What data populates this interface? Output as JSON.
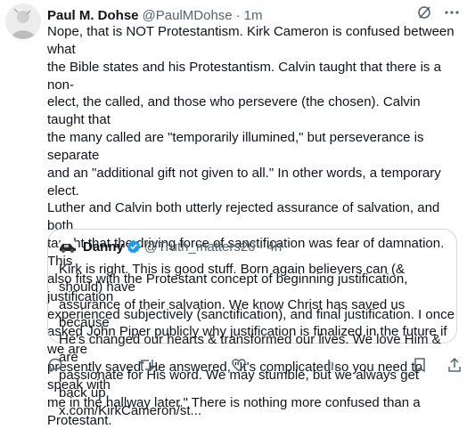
{
  "tweet": {
    "author_name": "Paul M. Dohse",
    "author_handle": "@PaulMDohse",
    "separator": "·",
    "time": "1m",
    "lines": [
      "Nope, that is NOT Protestantism. Kirk Cameron is confused between what",
      "the Bible states and his Protestantism. Calvin taught that there is a non-",
      "elect, the called, and those who persevere (the chosen). Calvin taught that",
      "the many called are \"temporarily illumined,\" but perseverance is separate",
      "and an \"additional gift not given to all.\" In other words, a temporary elect.",
      "Luther and Calvin both utterly rejected assurance of salvation, and both",
      "taught that the driving force of sanctification was fear of damnation. This",
      "also fits with the Protestant concept of beginning justification, justification",
      "experienced subjectively (sanctification), and final justification. I once",
      "asked John Piper publicly why justification is finalized in the future if we are",
      "presently saved. He answered, \"It's complicated so you need to speak with",
      "me in the hallway later.\" There is nothing more confused than a Protestant."
    ]
  },
  "quoted_tweet": {
    "author_name": "Danny",
    "author_handle": "@Truth_matters20",
    "separator": "·",
    "time": "4h",
    "lines": [
      "Kirk is right. This is good stuff. Born again believers can (& should) have",
      "assurance of their salvation. We know Christ has saved us because",
      "He's changed our hearts & transformed our lives. We love Him & are",
      "passionate for His word. We may stumble, but we always get back up.",
      "x.com/KirkCameron/st..."
    ]
  },
  "icons": {
    "header": [
      "grok-icon",
      "more-icon"
    ],
    "actions": [
      "reply-icon",
      "retweet-icon",
      "like-icon",
      "views-icon",
      "bookmark-icon",
      "share-icon"
    ]
  },
  "colors": {
    "text": "#0f1419",
    "secondary": "#536471",
    "border": "#cfd9de",
    "verified": "#1d9bf0"
  }
}
